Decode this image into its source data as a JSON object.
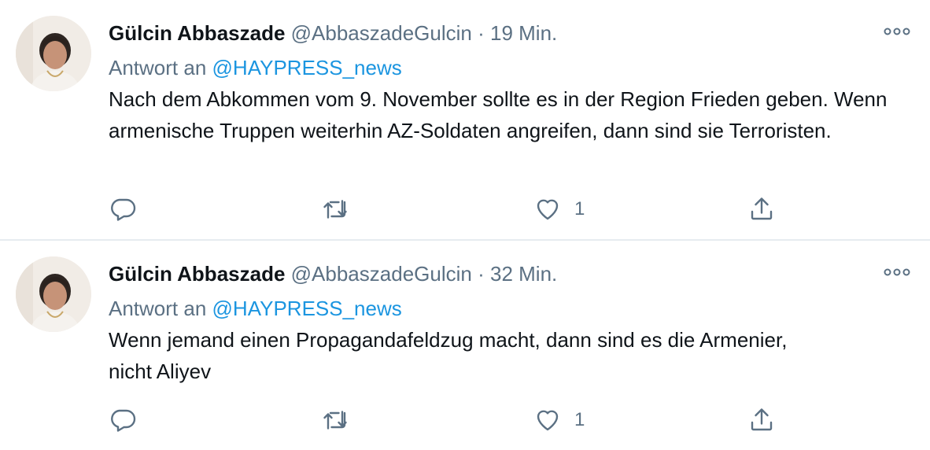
{
  "tweets": [
    {
      "name": "Gülcin Abbaszade",
      "handle": "@AbbaszadeGulcin",
      "separator": "·",
      "time": "19 Min.",
      "reply_prefix": "Antwort an",
      "reply_to": "@HAYPRESS_news",
      "text": "Nach dem Abkommen vom 9. November sollte es in der Region Frieden geben. Wenn armenische Truppen weiterhin AZ-Soldaten angreifen, dann sind sie Terroristen.",
      "like_count": "1",
      "icons": [
        "reply-icon",
        "retweet-icon",
        "like-icon",
        "share-icon",
        "more-icon"
      ]
    },
    {
      "name": "Gülcin Abbaszade",
      "handle": "@AbbaszadeGulcin",
      "separator": "·",
      "time": "32 Min.",
      "reply_prefix": "Antwort an",
      "reply_to": "@HAYPRESS_news",
      "text": "Wenn jemand einen Propagandafeldzug macht, dann sind es die Armenier, nicht Aliyev",
      "like_count": "1",
      "icons": [
        "reply-icon",
        "retweet-icon",
        "like-icon",
        "share-icon",
        "more-icon"
      ]
    }
  ],
  "colors": {
    "text": "#0f1419",
    "secondary": "#5b7083",
    "link": "#1b95e0",
    "divider": "#e6ecf0"
  }
}
